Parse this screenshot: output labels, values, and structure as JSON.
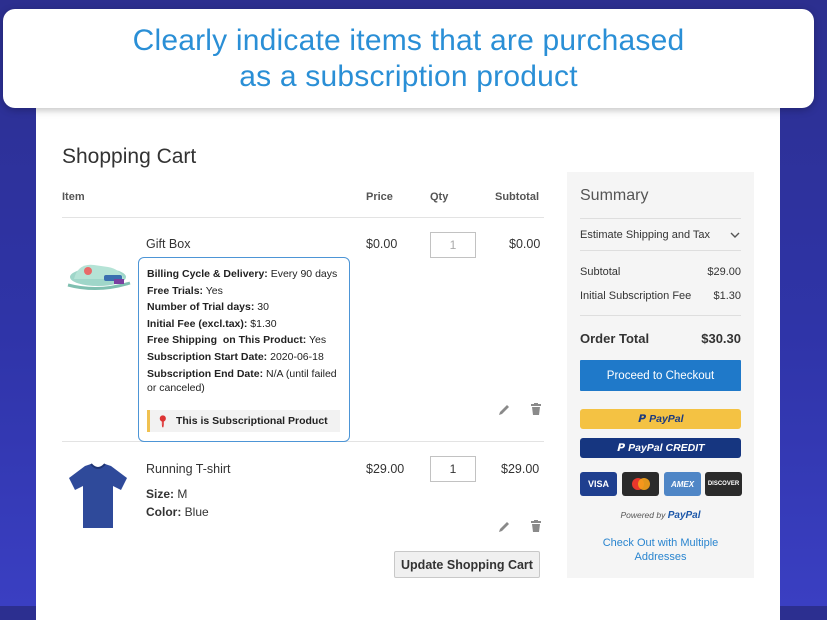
{
  "banner": {
    "line1": "Clearly indicate items that are purchased",
    "line2": "as a subscription product"
  },
  "cart": {
    "title": "Shopping Cart",
    "columns": {
      "item": "Item",
      "price": "Price",
      "qty": "Qty",
      "subtotal": "Subtotal"
    },
    "items": [
      {
        "name": "Gift Box",
        "price": "$0.00",
        "qty": "1",
        "subtotal": "$0.00",
        "tooltip": {
          "lines": [
            {
              "label": "Billing Cycle & Delivery:",
              "value": " Every 90 days"
            },
            {
              "label": "Free Trials:",
              "value": " Yes"
            },
            {
              "label": "Number of Trial days:",
              "value": " 30"
            },
            {
              "label": "Initial Fee (excl.tax):",
              "value": " $1.30"
            },
            {
              "label": "Free Shipping  on This Product:",
              "value": " Yes"
            },
            {
              "label": "Subscription Start Date:",
              "value": " 2020-06-18"
            },
            {
              "label": "Subscription End Date:",
              "value": " N/A (until failed or canceled)"
            }
          ],
          "badge": "This is Subscriptional Product"
        }
      },
      {
        "name": "Running T-shirt",
        "price": "$29.00",
        "qty": "1",
        "subtotal": "$29.00",
        "size_label": "Size:",
        "size_value": " M",
        "color_label": "Color:",
        "color_value": " Blue"
      }
    ],
    "update_button": "Update Shopping Cart"
  },
  "summary": {
    "title": "Summary",
    "estimate": "Estimate Shipping and Tax",
    "subtotal_label": "Subtotal",
    "subtotal_value": "$29.00",
    "fee_label": "Initial Subscription Fee",
    "fee_value": "$1.30",
    "total_label": "Order Total",
    "total_value": "$30.30",
    "checkout_button": "Proceed to Checkout",
    "paypal_label": "PayPal",
    "paypal_credit_label": "PayPal CREDIT",
    "cards": [
      "VISA",
      "",
      "AMEX",
      "DISCOVER"
    ],
    "powered_by": "Powered by",
    "powered_brand": "PayPal",
    "multi_line1": "Check Out with Multiple",
    "multi_line2": "Addresses"
  },
  "colors": {
    "accent": "#1f79c9",
    "banner_text": "#2a8fd6",
    "paypal_gold": "#f4c243",
    "paypal_navy": "#163680"
  },
  "icons": [
    "edit-icon",
    "trash-icon",
    "chevron-down-icon",
    "pin-icon",
    "paypal-icon"
  ]
}
